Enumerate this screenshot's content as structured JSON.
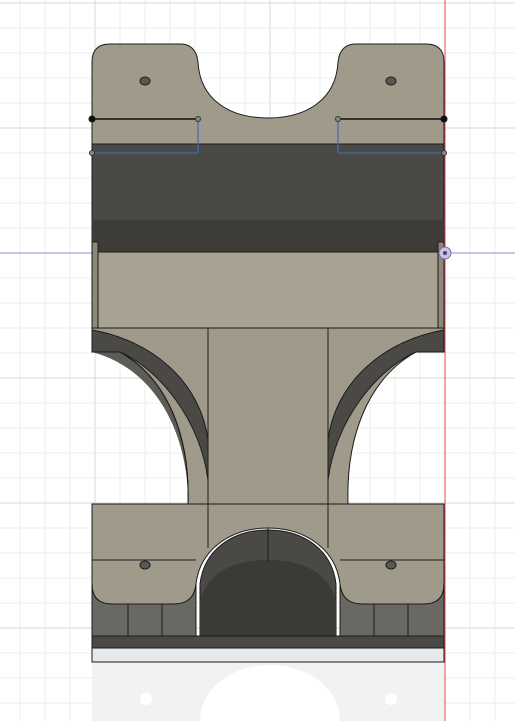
{
  "viewport": {
    "background": "#ffffff",
    "grid_color_minor": "#ececec",
    "grid_color_major": "#d9d9d9",
    "axis_red": "#e0464f",
    "axis_blue": "#8a95c9"
  },
  "model": {
    "body_color": "#a09a8b",
    "body_dark": "#4a4945",
    "body_shadow": "#3a3a37",
    "edge_color": "#1c1c1c",
    "sketch_color": "#3c6fb0",
    "base_strip": "#e6e9ea",
    "ghost_reflection": "#eeeeee"
  },
  "origin_marker": {
    "icon": "origin-point-icon"
  }
}
